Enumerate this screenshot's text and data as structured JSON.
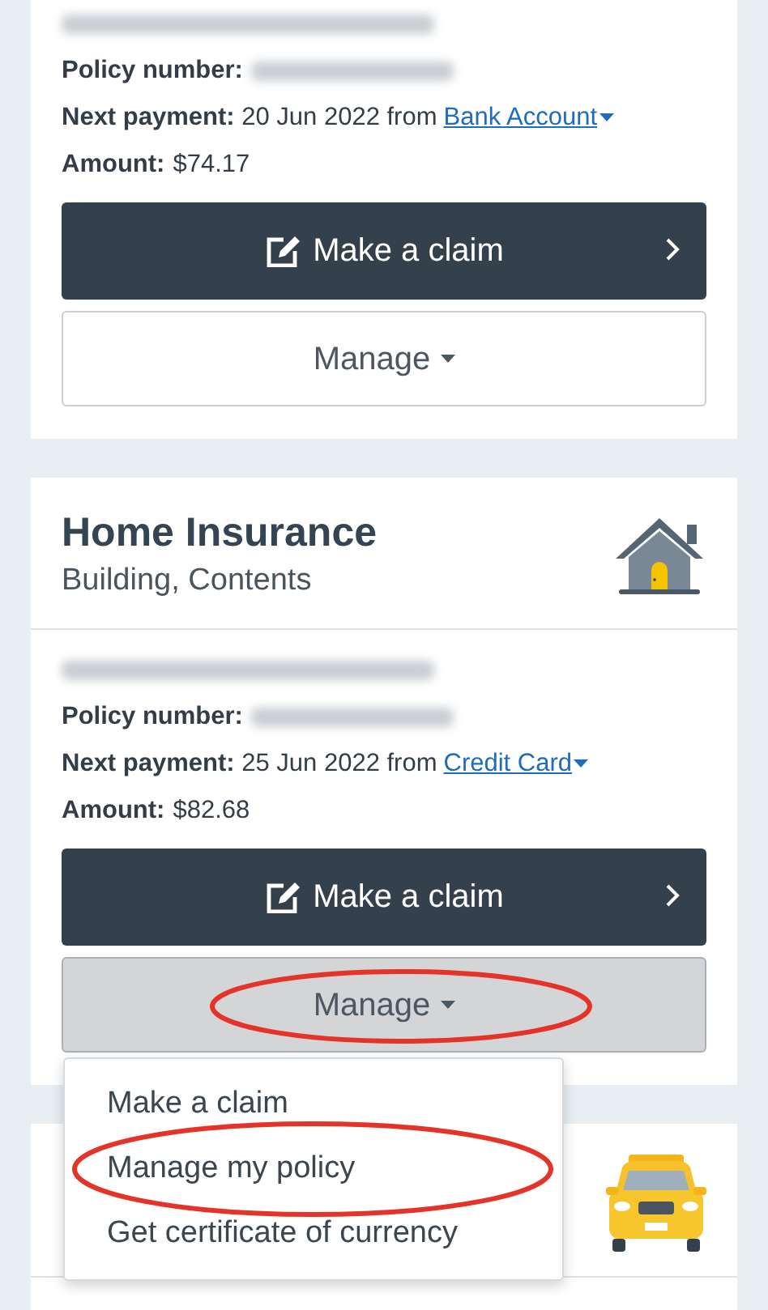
{
  "policies": [
    {
      "address_redacted": true,
      "policy_number_label": "Policy number:",
      "policy_number_redacted": true,
      "payment_text": "**Next payment:** 20 Jun 2022 from",
      "payment_method": "Bank Account",
      "amount_text": "**Amount:** $74.17",
      "claim_button": "Make a claim",
      "manage_button": {
        "label": "Manage",
        "expanded": false
      }
    },
    {
      "title": "Home Insurance",
      "subtitle": "Building, Contents",
      "address_redacted": true,
      "policy_number_label": "Policy number:",
      "policy_number_redacted": true,
      "payment_text": "**Next payment:** 25 Jun 2022 from",
      "payment_method": "Credit Card",
      "amount_text": "**Amount:** $82.68",
      "claim_button": "Make a claim",
      "manage_button": {
        "label": "Manage",
        "expanded": true,
        "circled": true
      }
    },
    {
      "kind": "header_only"
    }
  ],
  "dropdown": {
    "items": [
      {
        "label": "Make a claim",
        "circled": false
      },
      {
        "label": "Manage my policy",
        "circled": true
      },
      {
        "label": "Get certificate of currency",
        "circled": false
      }
    ]
  }
}
